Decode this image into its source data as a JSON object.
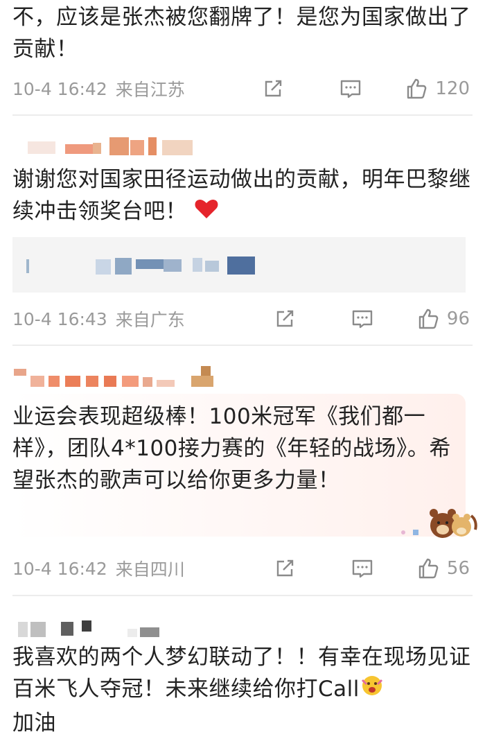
{
  "comments": [
    {
      "text": "不，应该是张杰被您翻牌了！是您为国家做出了贡献！",
      "time": "10-4 16:42",
      "location": "来自江苏",
      "likes": "120"
    },
    {
      "text": "谢谢您对国家田径运动做出的贡献，明年巴黎继续冲击领奖台吧！",
      "time": "10-4 16:43",
      "location": "来自广东",
      "likes": "96"
    },
    {
      "text": "业运会表现超级棒！100米冠军《我们都一样》，团队4*100接力赛的《年轻的战场》。希望张杰的歌声可以给你更多力量！",
      "time": "10-4 16:42",
      "location": "来自四川",
      "likes": "56"
    },
    {
      "text": "我喜欢的两个人梦幻联动了！！有幸在现场见证百米飞人夺冠！未来继续给你打Call",
      "text_tail": "加油"
    }
  ],
  "icons": {
    "share": "share-icon",
    "comment": "comment-icon",
    "like": "thumbs-up-icon",
    "heart": "heart-emoji",
    "bear": "bear-sticker",
    "cheer": "cheer-emoji"
  },
  "colors": {
    "meta_gray": "#9a9a9a",
    "heart_red": "#e5242b",
    "divider": "#ececec"
  }
}
